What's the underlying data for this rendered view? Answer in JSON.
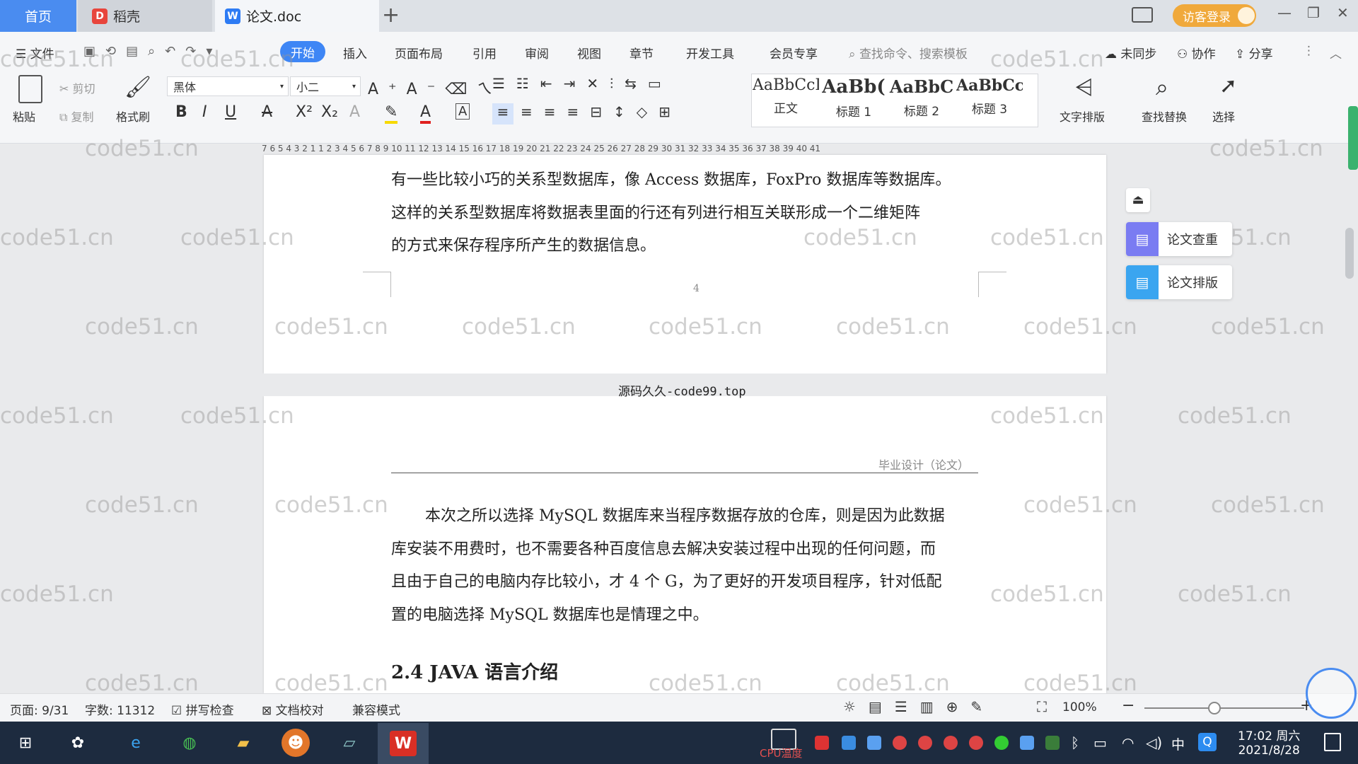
{
  "titlebar": {
    "tab_home": "首页",
    "tab_daoke": "稻壳",
    "tab_doc": "论文.doc",
    "new_tab": "+",
    "login": "访客登录"
  },
  "menu": {
    "file": "文件",
    "start": "开始",
    "insert": "插入",
    "layout": "页面布局",
    "reference": "引用",
    "review": "审阅",
    "view": "视图",
    "chapter": "章节",
    "devtools": "开发工具",
    "member": "会员专享",
    "search_placeholder": "查找命令、搜索模板",
    "unsynced": "未同步",
    "collab": "协作",
    "share": "分享"
  },
  "ribbon": {
    "paste": "粘贴",
    "cut": "剪切",
    "copy": "复制",
    "format_painter": "格式刷",
    "font_name": "黑体",
    "font_size": "小二",
    "text_layout": "文字排版",
    "find_replace": "查找替换",
    "select": "选择",
    "styles": [
      {
        "preview": "AaBbCcI",
        "label": "正文"
      },
      {
        "preview": "AaBb(",
        "label": "标题 1"
      },
      {
        "preview": "AaBbC",
        "label": "标题 2"
      },
      {
        "preview": "AaBbCcl",
        "label": "标题 3"
      }
    ]
  },
  "ruler": "7  6  5  4  3  2  1     1  2  3  4  5  6  7  8  9  10 11 12 13 14 15 16 17 18 19 20 21 22 23 24 25 26 27 28 29 30 31 32 33 34 35 36 37 38 39 40 41",
  "doc": {
    "p1": [
      "有一些比较小巧的关系型数据库，像 Access 数据库，FoxPro 数据库等数据库。",
      "这样的关系型数据库将数据表里面的行还有列进行相互关联形成一个二维矩阵",
      "的方式来保存程序所产生的数据信息。"
    ],
    "page_number": "4",
    "source_banner": "源码久久-code99.top",
    "header": "毕业设计（论文）",
    "p2": [
      "本次之所以选择 MySQL 数据库来当程序数据存放的仓库，则是因为此数据",
      "库安装不用费时，也不需要各种百度信息去解决安装过程中出现的任何问题，而",
      "且由于自己的电脑内存比较小，才 4 个 G，为了更好的开发项目程序，针对低配",
      "置的电脑选择 MySQL 数据库也是情理之中。"
    ],
    "heading": "2.4 JAVA 语言介绍",
    "watermark": "code51.cn"
  },
  "side": {
    "check": "论文查重",
    "format": "论文排版"
  },
  "status": {
    "page": "页面: 9/31",
    "words": "字数: 11312",
    "spell": "拼写检查",
    "proof": "文档校对",
    "compat": "兼容模式",
    "zoom": "100%"
  },
  "taskbar": {
    "time": "17:02 周六",
    "date": "2021/8/28",
    "ime": "中",
    "cpu_label": "CPU温度"
  },
  "colors": {
    "accent": "#3e86f5",
    "login": "#f0a93b",
    "taskbar": "#1d2b3f"
  }
}
